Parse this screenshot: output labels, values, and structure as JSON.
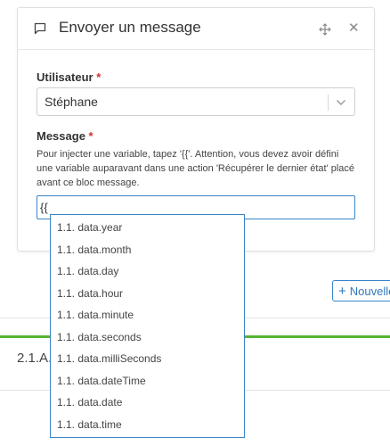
{
  "modal": {
    "title": "Envoyer un message",
    "user_label": "Utilisateur",
    "required_mark": "*",
    "user_value": "Stéphane",
    "message_label": "Message",
    "hint": "Pour injecter une variable, tapez '{{'. Attention, vous devez avoir défini une variable auparavant dans une action 'Récupérer le dernier état' placé avant ce bloc message.",
    "message_value": "{{"
  },
  "autocomplete": {
    "items": [
      "1.1. data.year",
      "1.1. data.month",
      "1.1. data.day",
      "1.1. data.hour",
      "1.1. data.minute",
      "1.1. data.seconds",
      "1.1. data.milliSeconds",
      "1.1. data.dateTime",
      "1.1. data.date",
      "1.1. data.time"
    ]
  },
  "background": {
    "new_button_label": "Nouvelle",
    "step_label": "2.1.A."
  },
  "colors": {
    "accent_blue": "#3a84c9",
    "success_green": "#55b433",
    "required_red": "#d32f2f"
  },
  "icons": {
    "header": "message-square-icon",
    "move": "move-icon",
    "close": "close-icon",
    "chevron": "chevron-down-icon",
    "plus": "plus-icon"
  }
}
